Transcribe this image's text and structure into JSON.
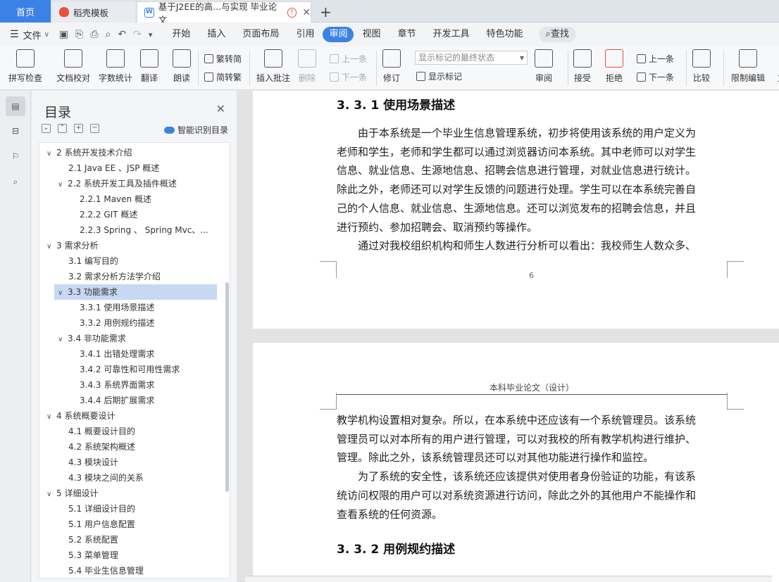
{
  "tabs": {
    "home": "首页",
    "template": "稻壳模板",
    "document": "基于J2EE的高...与实现 毕业论文"
  },
  "menu": {
    "file": "文件",
    "tabs": [
      "开始",
      "插入",
      "页面布局",
      "引用",
      "审阅",
      "视图",
      "章节",
      "开发工具",
      "特色功能"
    ],
    "active_tab": "审阅",
    "search": "查找"
  },
  "ribbon": {
    "spellcheck": "拼写检查",
    "proofread": "文档校对",
    "wordcount": "字数统计",
    "translate": "翻译",
    "read_aloud": "朗读",
    "to_traditional": "繁转简",
    "to_simplified": "简转繁",
    "insert_comment": "插入批注",
    "delete": "删除",
    "prev_item": "上一条",
    "next_item": "下一条",
    "revise": "修订",
    "markup_state": "显示标记的最终状态",
    "show_markup": "显示标记",
    "review": "审阅",
    "accept": "接受",
    "reject": "拒绝",
    "prev": "上一条",
    "next": "下一条",
    "compare": "比较",
    "restrict": "限制编辑",
    "cut_off": "文"
  },
  "toc": {
    "title": "目录",
    "smart": "智能识别目录",
    "items": [
      {
        "text": "2   系统开发技术介绍"
      },
      {
        "text": "2.1   Java EE 、JSP 概述"
      },
      {
        "text": "2.2 系统开发工具及插件概述"
      },
      {
        "text": "2.2.1 Maven  概述"
      },
      {
        "text": "2.2.2 GIT  概述"
      },
      {
        "text": "2.2.3 Spring 、 Spring Mvc、..."
      },
      {
        "text": "3     需求分析"
      },
      {
        "text": "3.1  编写目的"
      },
      {
        "text": "3.2  需求分析方法学介绍"
      },
      {
        "text": "3.3 功能需求"
      },
      {
        "text": "3.3.1 使用场景描述"
      },
      {
        "text": "3.3.2 用例规约描述"
      },
      {
        "text": "3.4  非功能需求"
      },
      {
        "text": "3.4.1  出错处理需求"
      },
      {
        "text": "3.4.2  可靠性和可用性需求"
      },
      {
        "text": "3.4.3  系统界面需求"
      },
      {
        "text": "3.4.4  后期扩展需求"
      },
      {
        "text": "4   系统概要设计"
      },
      {
        "text": "4.1  概要设计目的"
      },
      {
        "text": "4.2  系统架构概述"
      },
      {
        "text": "4.3  模块设计"
      },
      {
        "text": "4.3  模块之间的关系"
      },
      {
        "text": "5  详细设计"
      },
      {
        "text": "5.1  详细设计目的"
      },
      {
        "text": "5.1  用户信息配置"
      },
      {
        "text": "5.2  系统配置"
      },
      {
        "text": "5.3  菜单管理"
      },
      {
        "text": "5.4  毕业生信息管理"
      }
    ]
  },
  "document": {
    "heading1": "3. 3. 1 使用场景描述",
    "p1_lines": [
      "由于本系统是一个毕业生信息管理系统，初步将使用该系统的用户定义为",
      "老师和学生，老师和学生都可以通过浏览器访问本系统。其中老师可以对学生",
      "信息、就业信息、生源地信息、招聘会信息进行管理，对就业信息进行统计。",
      "除此之外，老师还可以对学生反馈的问题进行处理。学生可以在本系统完善自",
      "己的个人信息、就业信息、生源地信息。还可以浏览发布的招聘会信息，并且",
      "进行预约、参加招聘会、取消预约等操作。",
      "通过对我校组织机构和师生人数进行分析可以看出：我校师生人数众多、"
    ],
    "page_number": "6",
    "page_header": "本科毕业论文（设计）",
    "p2_lines": [
      "教学机构设置相对复杂。所以，在本系统中还应该有一个系统管理员。该系统",
      "管理员可以对本所有的用户进行管理，可以对我校的所有教学机构进行维护、",
      "管理。除此之外，该系统管理员还可以对其他功能进行操作和监控。",
      "为了系统的安全性，该系统还应该提供对使用者身份验证的功能，有该系",
      "统访问权限的用户可以对系统资源进行访问，除此之外的其他用户不能操作和",
      "查看系统的任何资源。"
    ],
    "heading2": "3. 3. 2 用例规约描述"
  },
  "colors": {
    "accent": "#3b82e6",
    "selection": "#c7d8f2"
  }
}
